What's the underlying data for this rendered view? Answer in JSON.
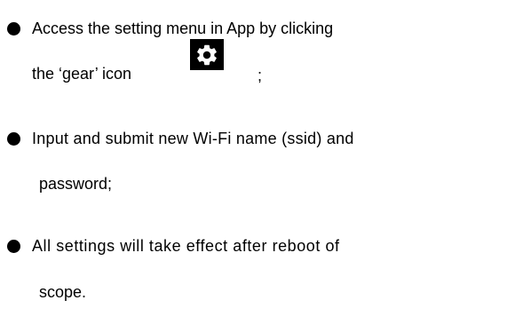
{
  "bullets": [
    {
      "lines": [
        "Access the setting menu in App by clicking",
        "the ‘gear’ icon",
        ";"
      ],
      "icon": "gear-icon"
    },
    {
      "lines": [
        "Input and submit new Wi-Fi name (ssid) and",
        "password;"
      ]
    },
    {
      "lines": [
        "All settings will take effect after reboot of",
        "scope."
      ]
    }
  ],
  "colors": {
    "text": "#000000",
    "background": "#ffffff",
    "icon_bg": "#000000",
    "icon_fg": "#ffffff"
  }
}
